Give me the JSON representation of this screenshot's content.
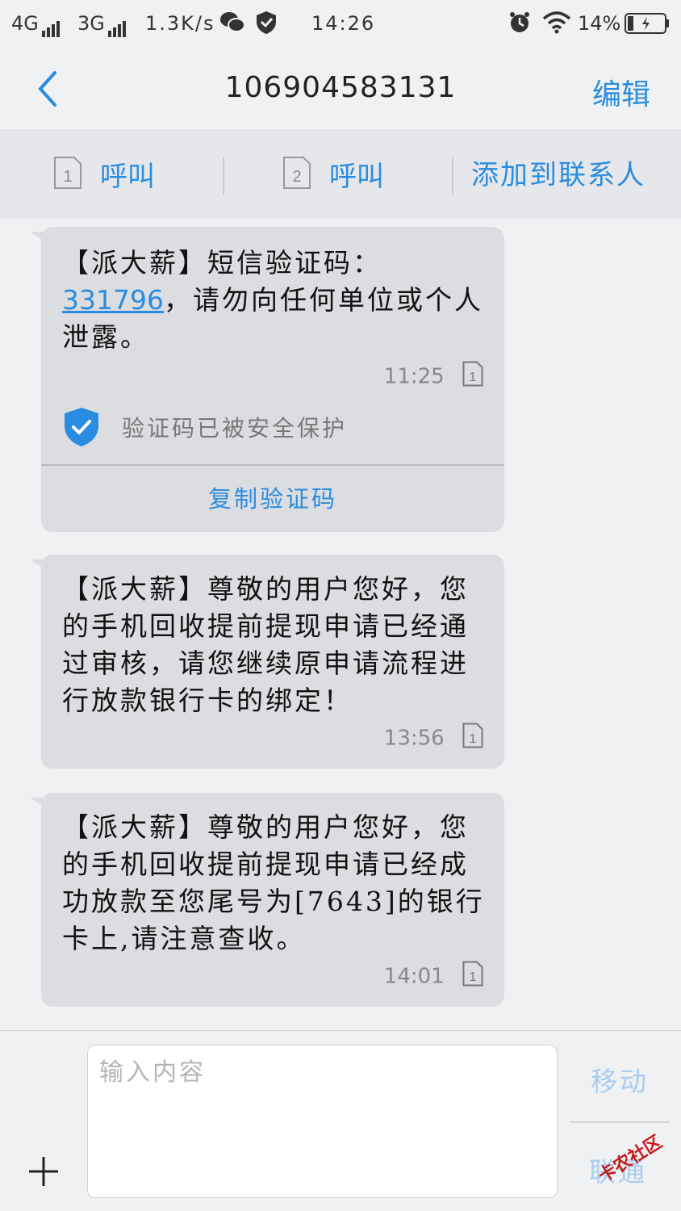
{
  "status_bar": {
    "network1": "4G",
    "network2": "3G",
    "speed": "1.3K/s",
    "time": "14:26",
    "battery": "14%"
  },
  "header": {
    "title": "106904583131",
    "edit_label": "编辑"
  },
  "actions": {
    "call1_label": "呼叫",
    "sim1": "1",
    "call2_label": "呼叫",
    "sim2": "2",
    "add_contact_label": "添加到联系人"
  },
  "messages": [
    {
      "text_prefix": "【派大薪】短信验证码：",
      "code": "331796",
      "text_suffix": "，请勿向任何单位或个人泄露。",
      "time": "11:25",
      "sim": "1",
      "protect_text": "验证码已被安全保护",
      "copy_label": "复制验证码"
    },
    {
      "text": "【派大薪】尊敬的用户您好，您的手机回收提前提现申请已经通过审核，请您继续原申请流程进行放款银行卡的绑定！",
      "time": "13:56",
      "sim": "1"
    },
    {
      "text": "【派大薪】尊敬的用户您好，您的手机回收提前提现申请已经成功放款至您尾号为[7643]的银行卡上,请注意查收。",
      "time": "14:01",
      "sim": "1"
    }
  ],
  "composer": {
    "placeholder": "输入内容",
    "move_label": "移动",
    "send_label": "联通"
  },
  "watermark": "卡农社区",
  "colors": {
    "accent": "#2a8ce0",
    "bubble": "#dcdde1",
    "background": "#f0f1f3"
  }
}
